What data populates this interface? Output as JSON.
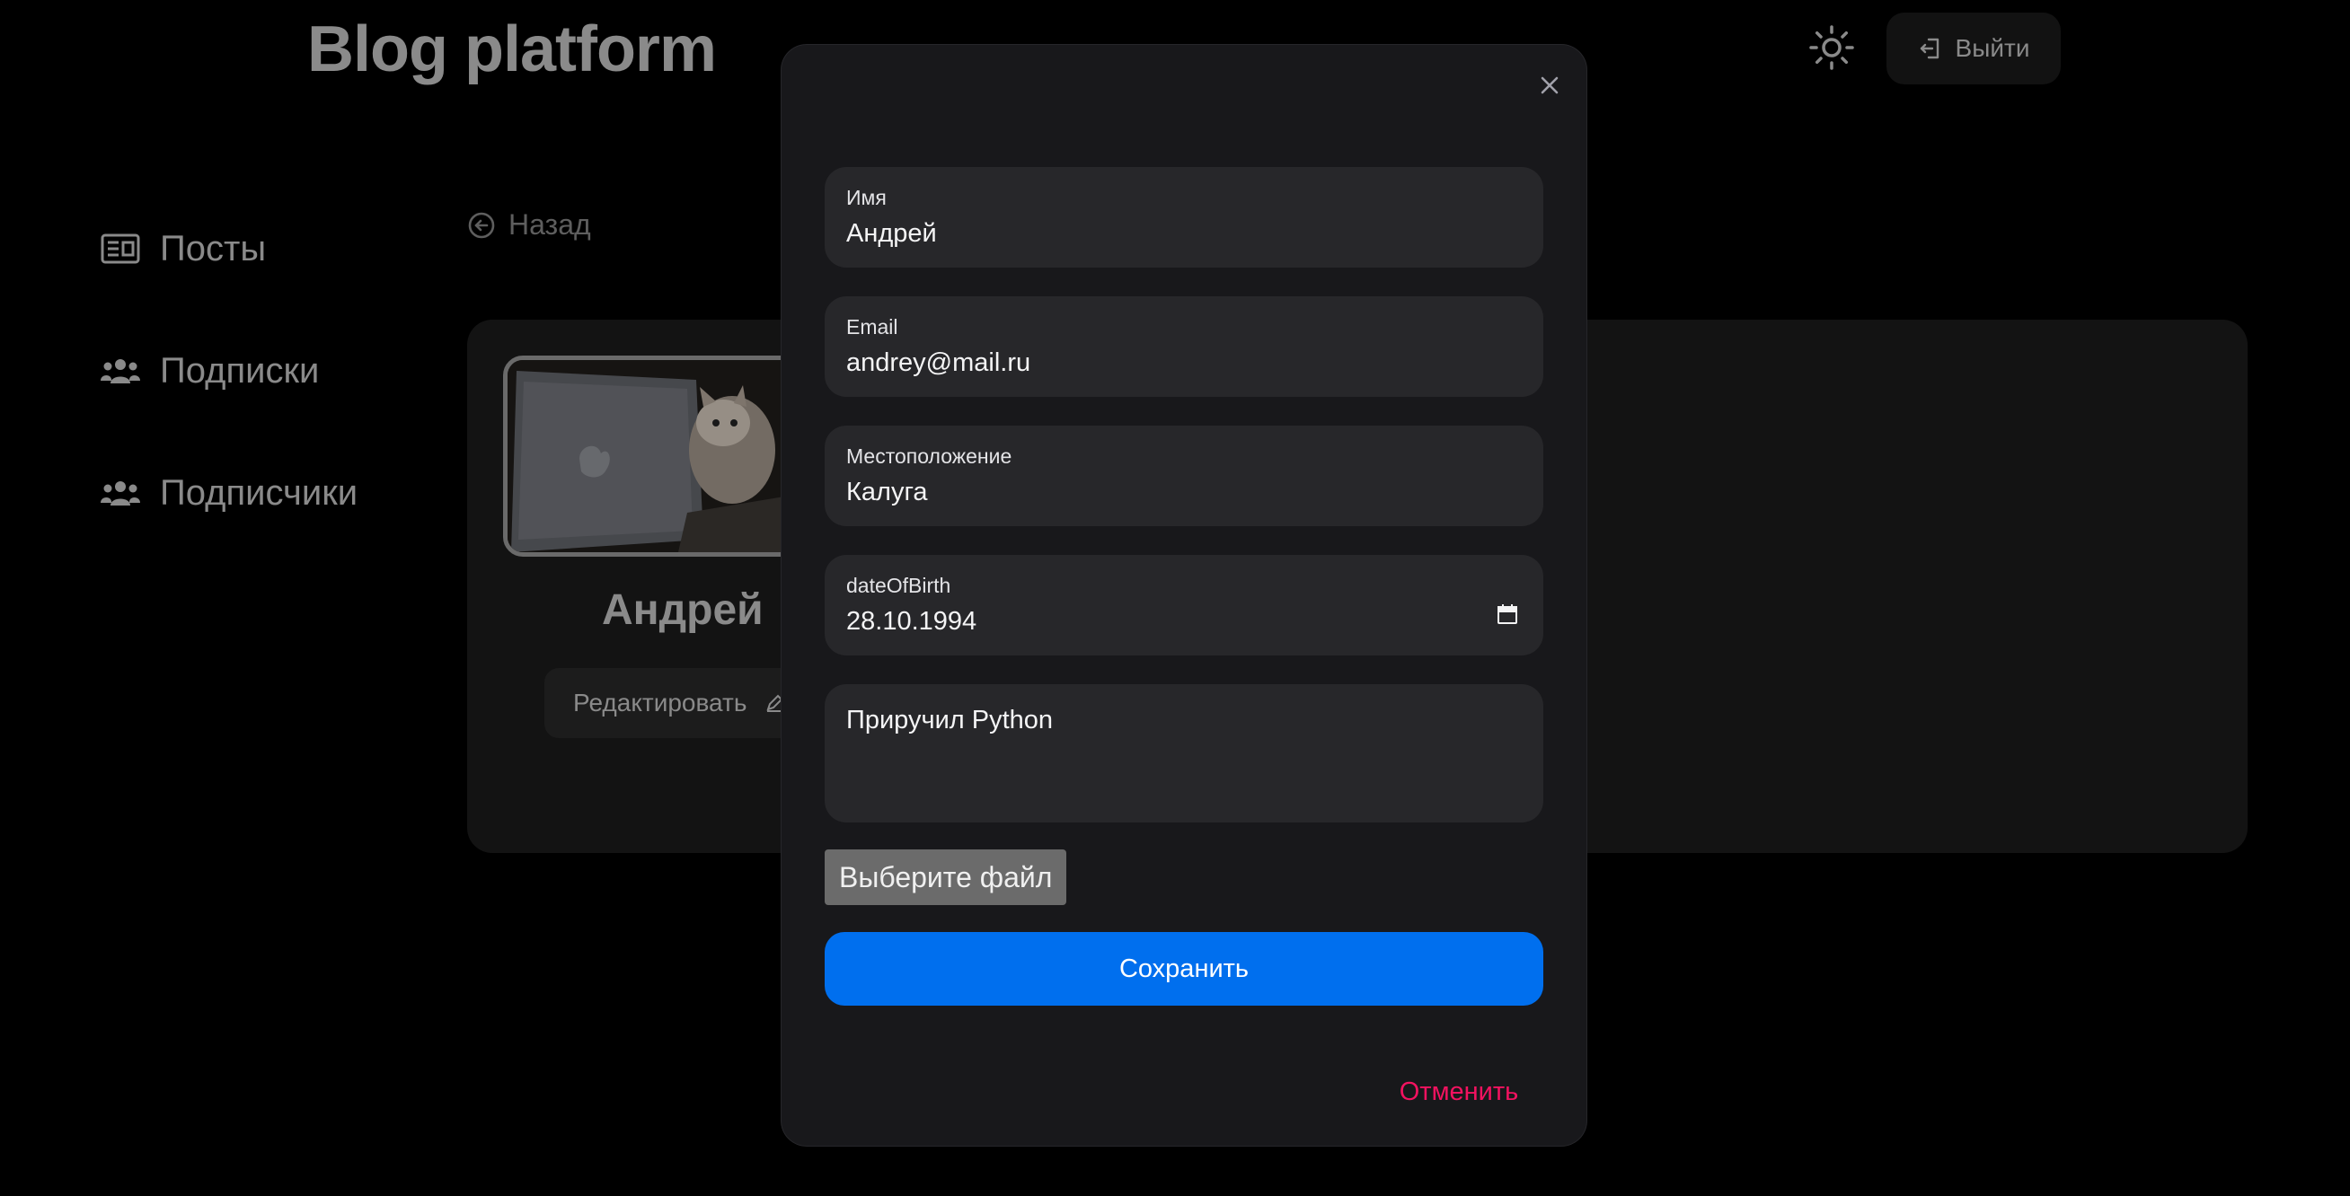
{
  "header": {
    "brand": "Blog platform",
    "logout_label": "Выйти"
  },
  "sidebar": {
    "items": [
      {
        "label": "Посты",
        "icon": "newspaper-icon"
      },
      {
        "label": "Подписки",
        "icon": "users-icon"
      },
      {
        "label": "Подписчики",
        "icon": "users-icon"
      }
    ]
  },
  "profile": {
    "back_label": "Назад",
    "name": "Андрей",
    "edit_label": "Редактировать"
  },
  "modal": {
    "fields": {
      "name": {
        "label": "Имя",
        "value": "Андрей"
      },
      "email": {
        "label": "Email",
        "value": "andrey@mail.ru"
      },
      "location": {
        "label": "Местоположение",
        "value": "Калуга"
      },
      "dob": {
        "label": "dateOfBirth",
        "value": "28.10.1994"
      }
    },
    "bio": "Приручил Python",
    "file_button": "Выберите файл",
    "save_label": "Сохранить",
    "cancel_label": "Отменить"
  },
  "colors": {
    "primary": "#006fee",
    "danger": "#f31260",
    "modal_bg": "#18181b",
    "field_bg": "#27272a"
  }
}
